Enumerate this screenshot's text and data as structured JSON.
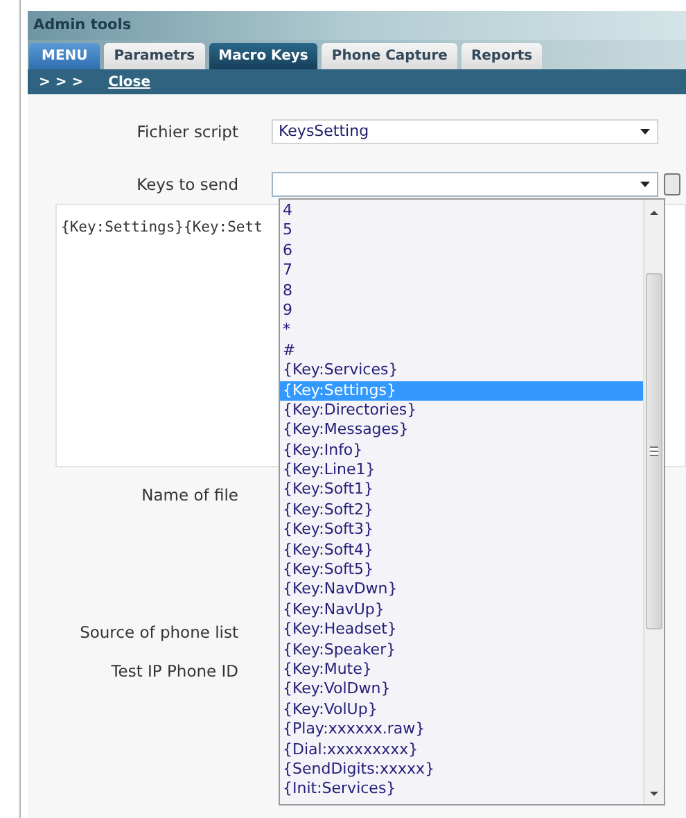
{
  "window": {
    "title": "Admin tools"
  },
  "menu_button": "MENU",
  "tabs": [
    {
      "label": "Parametrs",
      "selected": false
    },
    {
      "label": "Macro Keys",
      "selected": true
    },
    {
      "label": "Phone Capture",
      "selected": false
    },
    {
      "label": "Reports",
      "selected": false
    }
  ],
  "subbar": {
    "arrows": "> > >",
    "close_link": "Close"
  },
  "form": {
    "fichier_script": {
      "label": "Fichier script",
      "value": "KeysSetting"
    },
    "keys_to_send": {
      "label": "Keys to send",
      "open": true,
      "options": [
        {
          "label": "4",
          "selected": false
        },
        {
          "label": "5",
          "selected": false
        },
        {
          "label": "6",
          "selected": false
        },
        {
          "label": "7",
          "selected": false
        },
        {
          "label": "8",
          "selected": false
        },
        {
          "label": "9",
          "selected": false
        },
        {
          "label": "*",
          "selected": false
        },
        {
          "label": "#",
          "selected": false
        },
        {
          "label": "{Key:Services}",
          "selected": false
        },
        {
          "label": "{Key:Settings}",
          "selected": true
        },
        {
          "label": "{Key:Directories}",
          "selected": false
        },
        {
          "label": "{Key:Messages}",
          "selected": false
        },
        {
          "label": "{Key:Info}",
          "selected": false
        },
        {
          "label": "{Key:Line1}",
          "selected": false
        },
        {
          "label": "{Key:Soft1}",
          "selected": false
        },
        {
          "label": "{Key:Soft2}",
          "selected": false
        },
        {
          "label": "{Key:Soft3}",
          "selected": false
        },
        {
          "label": "{Key:Soft4}",
          "selected": false
        },
        {
          "label": "{Key:Soft5}",
          "selected": false
        },
        {
          "label": "{Key:NavDwn}",
          "selected": false
        },
        {
          "label": "{Key:NavUp}",
          "selected": false
        },
        {
          "label": "{Key:Headset}",
          "selected": false
        },
        {
          "label": "{Key:Speaker}",
          "selected": false
        },
        {
          "label": "{Key:Mute}",
          "selected": false
        },
        {
          "label": "{Key:VolDwn}",
          "selected": false
        },
        {
          "label": "{Key:VolUp}",
          "selected": false
        },
        {
          "label": "{Play:xxxxxx.raw}",
          "selected": false
        },
        {
          "label": "{Dial:xxxxxxxxx}",
          "selected": false
        },
        {
          "label": "{SendDigits:xxxxx}",
          "selected": false
        },
        {
          "label": "{Init:Services}",
          "selected": false
        }
      ]
    },
    "script_text": "{Key:Settings}{Key:Sett",
    "name_of_file": {
      "label": "Name of file"
    },
    "source_of_phone_list": {
      "label": "Source of phone list"
    },
    "test_ip_phone_id": {
      "label": "Test IP Phone ID"
    }
  }
}
